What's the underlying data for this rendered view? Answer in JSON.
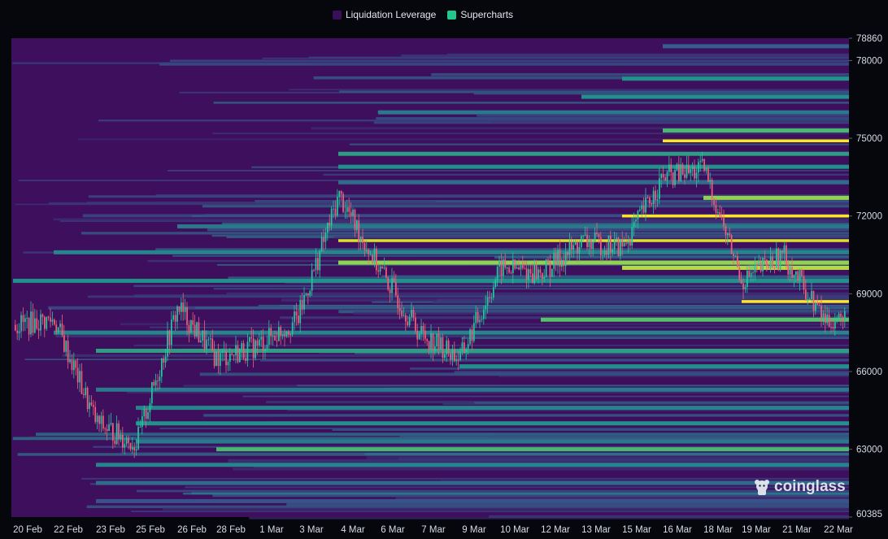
{
  "colors": {
    "background": "#05070c",
    "heatmap_base": "#3e0f5c",
    "candle_up": "#26c6a0",
    "candle_down": "#f0607a",
    "legend_leverage": "#3a0f5a",
    "legend_supercharts": "#20c98b"
  },
  "legend": {
    "leverage_label": "Liquidation Leverage",
    "supercharts_label": "Supercharts"
  },
  "watermark": {
    "text": "coinglass",
    "icon": "coinglass-mascot-icon"
  },
  "chart_data": {
    "type": "heatmap",
    "title": "",
    "xlabel": "",
    "ylabel": "",
    "ylim": [
      60385,
      78860
    ],
    "y_ticks": [
      "78860",
      "78000",
      "75000",
      "72000",
      "69000",
      "66000",
      "63000",
      "60385"
    ],
    "x_ticks": [
      "20 Feb",
      "22 Feb",
      "23 Feb",
      "25 Feb",
      "26 Feb",
      "28 Feb",
      "1 Mar",
      "3 Mar",
      "4 Mar",
      "6 Mar",
      "7 Mar",
      "9 Mar",
      "10 Mar",
      "12 Mar",
      "13 Mar",
      "15 Mar",
      "16 Mar",
      "18 Mar",
      "19 Mar",
      "21 Mar",
      "22 Mar"
    ],
    "grid": false,
    "legend_position": "top-center",
    "price_series": {
      "name": "Supercharts",
      "anchor_dates": [
        "20 Feb",
        "22 Feb",
        "23 Feb",
        "25 Feb",
        "26 Feb",
        "28 Feb",
        "1 Mar",
        "3 Mar",
        "4 Mar",
        "6 Mar",
        "7 Mar",
        "9 Mar",
        "10 Mar",
        "12 Mar",
        "13 Mar",
        "15 Mar",
        "16 Mar",
        "18 Mar",
        "19 Mar",
        "21 Mar",
        "22 Mar"
      ],
      "anchor_prices": [
        67800,
        68000,
        64000,
        63200,
        68500,
        66500,
        67000,
        68000,
        72800,
        70000,
        67500,
        66500,
        70000,
        69800,
        71000,
        70800,
        73500,
        73800,
        69500,
        70500,
        68000
      ]
    },
    "liquidation_bands": [
      {
        "price": 78550,
        "level": 0.35,
        "start": "16 Mar"
      },
      {
        "price": 77300,
        "level": 0.55,
        "start": "15 Mar"
      },
      {
        "price": 76600,
        "level": 0.55,
        "start": "13 Mar"
      },
      {
        "price": 76000,
        "level": 0.45,
        "start": "6 Mar"
      },
      {
        "price": 75300,
        "level": 0.7,
        "start": "16 Mar"
      },
      {
        "price": 74900,
        "level": 1.0,
        "start": "16 Mar"
      },
      {
        "price": 74400,
        "level": 0.6,
        "start": "4 Mar"
      },
      {
        "price": 73900,
        "level": 0.55,
        "start": "4 Mar"
      },
      {
        "price": 73300,
        "level": 0.4,
        "start": "4 Mar"
      },
      {
        "price": 72700,
        "level": 0.85,
        "start": "18 Mar"
      },
      {
        "price": 72000,
        "level": 1.0,
        "start": "15 Mar"
      },
      {
        "price": 71600,
        "level": 0.45,
        "start": "26 Feb"
      },
      {
        "price": 71050,
        "level": 0.95,
        "start": "4 Mar"
      },
      {
        "price": 70600,
        "level": 0.5,
        "start": "22 Feb"
      },
      {
        "price": 70200,
        "level": 0.85,
        "start": "4 Mar"
      },
      {
        "price": 70000,
        "level": 0.9,
        "start": "15 Mar"
      },
      {
        "price": 69500,
        "level": 0.55,
        "start": "20 Feb"
      },
      {
        "price": 68700,
        "level": 1.0,
        "start": "19 Mar"
      },
      {
        "price": 68000,
        "level": 0.75,
        "start": "12 Mar"
      },
      {
        "price": 67500,
        "level": 0.5,
        "start": "22 Feb"
      },
      {
        "price": 66800,
        "level": 0.6,
        "start": "23 Feb"
      },
      {
        "price": 66200,
        "level": 0.55,
        "start": "9 Mar"
      },
      {
        "price": 65300,
        "level": 0.45,
        "start": "23 Feb"
      },
      {
        "price": 64600,
        "level": 0.5,
        "start": "25 Feb"
      },
      {
        "price": 64000,
        "level": 0.55,
        "start": "25 Feb"
      },
      {
        "price": 63300,
        "level": 0.45,
        "start": "25 Feb"
      },
      {
        "price": 63000,
        "level": 0.7,
        "start": "28 Feb"
      },
      {
        "price": 62400,
        "level": 0.5,
        "start": "23 Feb"
      },
      {
        "price": 61700,
        "level": 0.4,
        "start": "23 Feb"
      },
      {
        "price": 61000,
        "level": 0.3,
        "start": "23 Feb"
      }
    ]
  }
}
